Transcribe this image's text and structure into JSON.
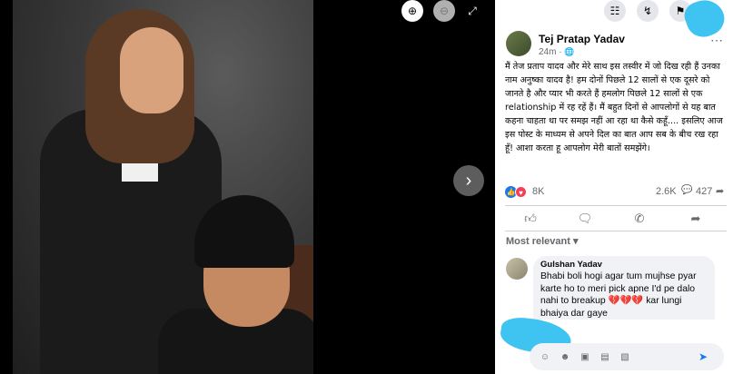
{
  "viewer": {
    "zoom_in_icon": "zoom-in-icon",
    "zoom_out_icon": "zoom-out-icon",
    "fullscreen_icon": "fullscreen-icon",
    "next_icon": "chevron-right-icon"
  },
  "topbar": {
    "icons": [
      "menu-grid-icon",
      "messenger-icon",
      "bell-icon"
    ]
  },
  "post": {
    "author": "Tej Pratap Yadav",
    "time": "24m",
    "text": "मैं तेज प्रताप यादव और मेरे साथ इस तस्वीर में जो दिख रही हैं उनका नाम अनुष्का यादव है! हम दोनों पिछले 12 सालों से एक दूसरे को जानते है और प्यार भी करते हैं हमलोग पिछले 12 सालों से एक relationship में रह रहें हैं। मैं बहुत दिनों से आपलोगों से यह बात कहना चाहता था पर समझ नहीं आ रहा था कैसे कहूँ.... इसलिए आज इस पोस्ट के माध्यम से अपने दिल का बात आप सब के बीच रख रहा हूँ! आशा करता हू आपलोग मेरी बातों समझेंगे।",
    "reactions_count": "8K",
    "comments_count": "2.6K",
    "shares_count": "427"
  },
  "comments_section": {
    "sort_label": "Most relevant",
    "comment": {
      "author": "Gulshan Yadav",
      "text": "Bhabi boli hogi agar tum mujhse pyar karte ho to meri pick apne I'd pe dalo nahi to breakup 💔💔💔 kar lungi bhaiya dar gaye"
    }
  },
  "colors": {
    "accent": "#1877f2",
    "love": "#f33e58",
    "redaction": "#35c0f0"
  }
}
